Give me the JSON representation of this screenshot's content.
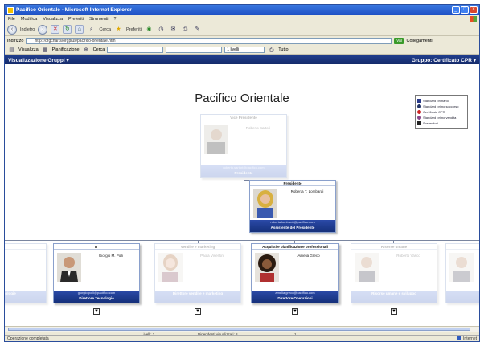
{
  "window": {
    "title": "Pacifico Orientale - Microsoft Internet Explorer",
    "controls": [
      "_",
      "□",
      "×"
    ]
  },
  "menu": [
    "File",
    "Modifica",
    "Visualizza",
    "Preferiti",
    "Strumenti",
    "?"
  ],
  "nav": {
    "back_label": "Indietro",
    "search_label": "Cerca",
    "favorites_label": "Preferiti"
  },
  "address": {
    "label": "Indirizzo",
    "value": "http://orgcharts/orgplus/pacifico-orientale.htm",
    "go_label": "Vai",
    "links_label": "Collegamenti"
  },
  "apptoolbar": {
    "view_label": "Visualizza",
    "print_label": "Pianificazione",
    "search_label": "Cerca",
    "field_value": "",
    "level_value": "1 livelli",
    "extra_label": "Tutto"
  },
  "header": {
    "left": "Visualizzazione Gruppi ▾",
    "right": "Gruppo: Certificato CPR ▾"
  },
  "chart": {
    "title": "Pacifico Orientale"
  },
  "legend": [
    {
      "label": "Standard primario",
      "color": "#2a3a8a"
    },
    {
      "label": "Standard primo soccorso",
      "color": "#223366"
    },
    {
      "label": "Certificato CPR",
      "color": "#cc2222"
    },
    {
      "label": "Standard primo vendita",
      "color": "#884488"
    },
    {
      "label": "Sostenitori",
      "color": "#222222"
    }
  ],
  "cards": {
    "top": {
      "title": "Vice Presidente",
      "name": "Roberto Sartori",
      "mail": "roberto.sartori@pacifico.com",
      "role": "Presidente"
    },
    "president": {
      "title": "Presidente",
      "name": "Roberta T. Lombardi",
      "mail": "roberta.lombardi@pacifico.com",
      "role": "Assistente del Presidente"
    },
    "tech": {
      "title": "IT",
      "name": "Giorgio M. Polli",
      "mail": "giorgio.polli@pacifico.com",
      "role": "Direttore Tecnologie"
    },
    "hr": {
      "title": "Acquisti e pianificazione professionali",
      "name": "Amelia Greco",
      "mail": "amelia.greco@pacifico.com",
      "role": "Direttore Operazioni"
    },
    "faded_left": {
      "title": "",
      "name": "",
      "mail": "",
      "role": "Tecnologie"
    },
    "faded_mid": {
      "title": "Vendite e marketing",
      "name": "Paola Visentini",
      "mail": "",
      "role": "Direttore vendite e marketing"
    },
    "faded_right": {
      "title": "Risorse umane",
      "name": "Roberto Vasco",
      "mail": "",
      "role": "Risorse umane e sviluppo"
    },
    "faded_far": {
      "title": "",
      "name": "",
      "mail": "",
      "role": ""
    }
  },
  "expand_symbol": "▼",
  "innerstatus": {
    "a": "Livelli: 2",
    "b": "Dipendenti visualizzati: 8",
    "c": "1"
  },
  "status": {
    "left": "Operazione completata",
    "right": "Internet"
  }
}
